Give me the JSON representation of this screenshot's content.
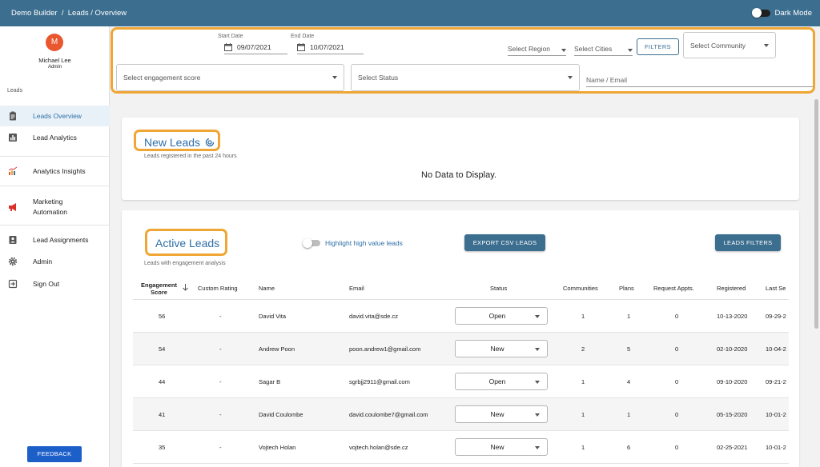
{
  "topbar": {
    "breadcrumb": "Demo Builder  /  Leads / Overview",
    "dark_mode_label": "Dark Mode"
  },
  "user": {
    "initial": "M",
    "name": "Michael Lee",
    "role": "Admin"
  },
  "sidebar": {
    "section_label": "Leads",
    "items": [
      {
        "label": "Leads Overview",
        "icon": "clipboard-icon"
      },
      {
        "label": "Lead Analytics",
        "icon": "bar-chart-icon"
      },
      {
        "label": "Analytics Insights",
        "icon": "line-chart-icon"
      },
      {
        "label": "Marketing Automation",
        "icon": "megaphone-icon"
      },
      {
        "label": "Lead Assignments",
        "icon": "assignment-icon"
      },
      {
        "label": "Admin",
        "icon": "gear-icon"
      },
      {
        "label": "Sign Out",
        "icon": "sign-out-icon"
      }
    ],
    "feedback_label": "FEEDBACK"
  },
  "filters": {
    "start_date_label": "Start Date",
    "start_date": "09/07/2021",
    "end_date_label": "End Date",
    "end_date": "10/07/2021",
    "region_placeholder": "Select Region",
    "cities_placeholder": "Select Cities",
    "filters_button": "FILTERS",
    "community_placeholder": "Select Community",
    "engagement_placeholder": "Select engagement score",
    "status_placeholder": "Select Status",
    "name_email_placeholder": "Name / Email"
  },
  "new_leads": {
    "title": "New Leads",
    "subtitle": "Leads registered in the past 24 hours",
    "empty": "No Data to Display."
  },
  "active_leads": {
    "title": "Active Leads",
    "subtitle": "Leads with engagement analysis",
    "highlight_label": "Highlight high value leads",
    "export_button": "EXPORT CSV LEADS",
    "filters_button": "LEADS FILTERS",
    "columns": {
      "engagement_line1": "Engagement",
      "engagement_line2": "Score",
      "custom_rating": "Custom Rating",
      "name": "Name",
      "email": "Email",
      "status": "Status",
      "communities": "Communities",
      "plans": "Plans",
      "request_appts": "Request Appts.",
      "registered": "Registered",
      "last_seen": "Last Se"
    },
    "rows": [
      {
        "score": "56",
        "rating": "-",
        "name": "David Vita",
        "email": "david.vita@sde.cz",
        "status": "Open",
        "communities": "1",
        "plans": "1",
        "appts": "0",
        "registered": "10-13-2020",
        "last_seen": "09-29-2"
      },
      {
        "score": "54",
        "rating": "-",
        "name": "Andrew Poon",
        "email": "poon.andrew1@gmail.com",
        "status": "New",
        "communities": "2",
        "plans": "5",
        "appts": "0",
        "registered": "02-10-2020",
        "last_seen": "10-04-2"
      },
      {
        "score": "44",
        "rating": "-",
        "name": "Sagar B",
        "email": "sgrbjj2911@gmail.com",
        "status": "Open",
        "communities": "1",
        "plans": "4",
        "appts": "0",
        "registered": "09-10-2020",
        "last_seen": "09-21-2"
      },
      {
        "score": "41",
        "rating": "-",
        "name": "David Coulombe",
        "email": "david.coulombe7@gmail.com",
        "status": "New",
        "communities": "1",
        "plans": "1",
        "appts": "0",
        "registered": "05-15-2020",
        "last_seen": "10-01-2"
      },
      {
        "score": "35",
        "rating": "-",
        "name": "Vojtech Holan",
        "email": "vojtech.holan@sde.cz",
        "status": "New",
        "communities": "1",
        "plans": "6",
        "appts": "0",
        "registered": "02-25-2021",
        "last_seen": "10-01-2"
      }
    ]
  },
  "colors": {
    "primary": "#3c6e8f",
    "accent_highlight": "#f0a634",
    "link": "#2e6fa7",
    "avatar": "#e9572e",
    "feedback": "#1d5fc9"
  }
}
